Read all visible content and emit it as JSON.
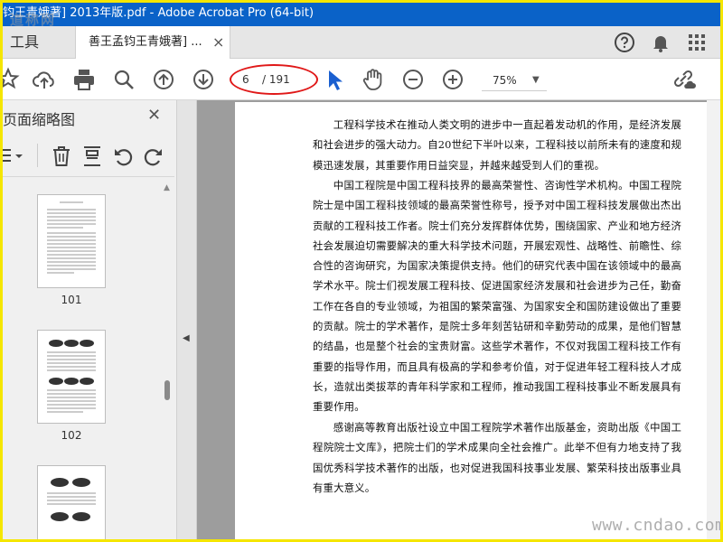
{
  "window": {
    "title": "钧王青娥著] 2013年版.pdf - Adobe Acrobat Pro (64-bit)"
  },
  "watermark": {
    "top_left": "道称网",
    "bottom_right": "www.cndao.com"
  },
  "tabs": {
    "tools_label": "工具",
    "doc_tab_label": "善王孟钧王青娥著] ...",
    "close_symbol": "×"
  },
  "header_icons": [
    "help-icon",
    "bell-icon",
    "apps-grid-icon"
  ],
  "toolbar": {
    "current_page": "6",
    "total_pages": "/ 191",
    "zoom": "75%",
    "zoom_caret": "▼",
    "highlight_color": "#e01818",
    "accent_color": "#1a5fd0"
  },
  "left_panel": {
    "title": "页面缩略图",
    "close_symbol": "✕",
    "thumbnails": [
      {
        "label": "101"
      },
      {
        "label": "102"
      },
      {
        "label": ""
      }
    ]
  },
  "document": {
    "paragraphs": [
      "工程科学技术在推动人类文明的进步中一直起着发动机的作用，是经济发展和社会进步的强大动力。自20世纪下半叶以来，工程科技以前所未有的速度和规模迅速发展，其重要作用日益突显，并越来越受到人们的重视。",
      "中国工程院是中国工程科技界的最高荣誉性、咨询性学术机构。中国工程院院士是中国工程科技领域的最高荣誉性称号，授予对中国工程科技发展做出杰出贡献的工程科技工作者。院士们充分发挥群体优势，围绕国家、产业和地方经济社会发展迫切需要解决的重大科学技术问题，开展宏观性、战略性、前瞻性、综合性的咨询研究，为国家决策提供支持。他们的研究代表中国在该领域中的最高学术水平。院士们视发展工程科技、促进国家经济发展和社会进步为己任，勤奋工作在各自的专业领域，为祖国的繁荣富强、为国家安全和国防建设做出了重要的贡献。院士的学术著作，是院士多年刻苦钻研和辛勤劳动的成果，是他们智慧的结晶，也是整个社会的宝贵财富。这些学术著作，不仅对我国工程科技工作有重要的指导作用，而且具有极高的学和参考价值，对于促进年轻工程科技人才成长，造就出类拔萃的青年科学家和工程师，推动我国工程科技事业不断发展具有重要作用。",
      "感谢高等教育出版社设立中国工程院学术著作出版基金，资助出版《中国工程院院士文库》，把院士们的学术成果向全社会推广。此举不但有力地支持了我国优秀科学技术著作的出版，也对促进我国科技事业发展、繁荣科技出版事业具有重大意义。"
    ]
  }
}
